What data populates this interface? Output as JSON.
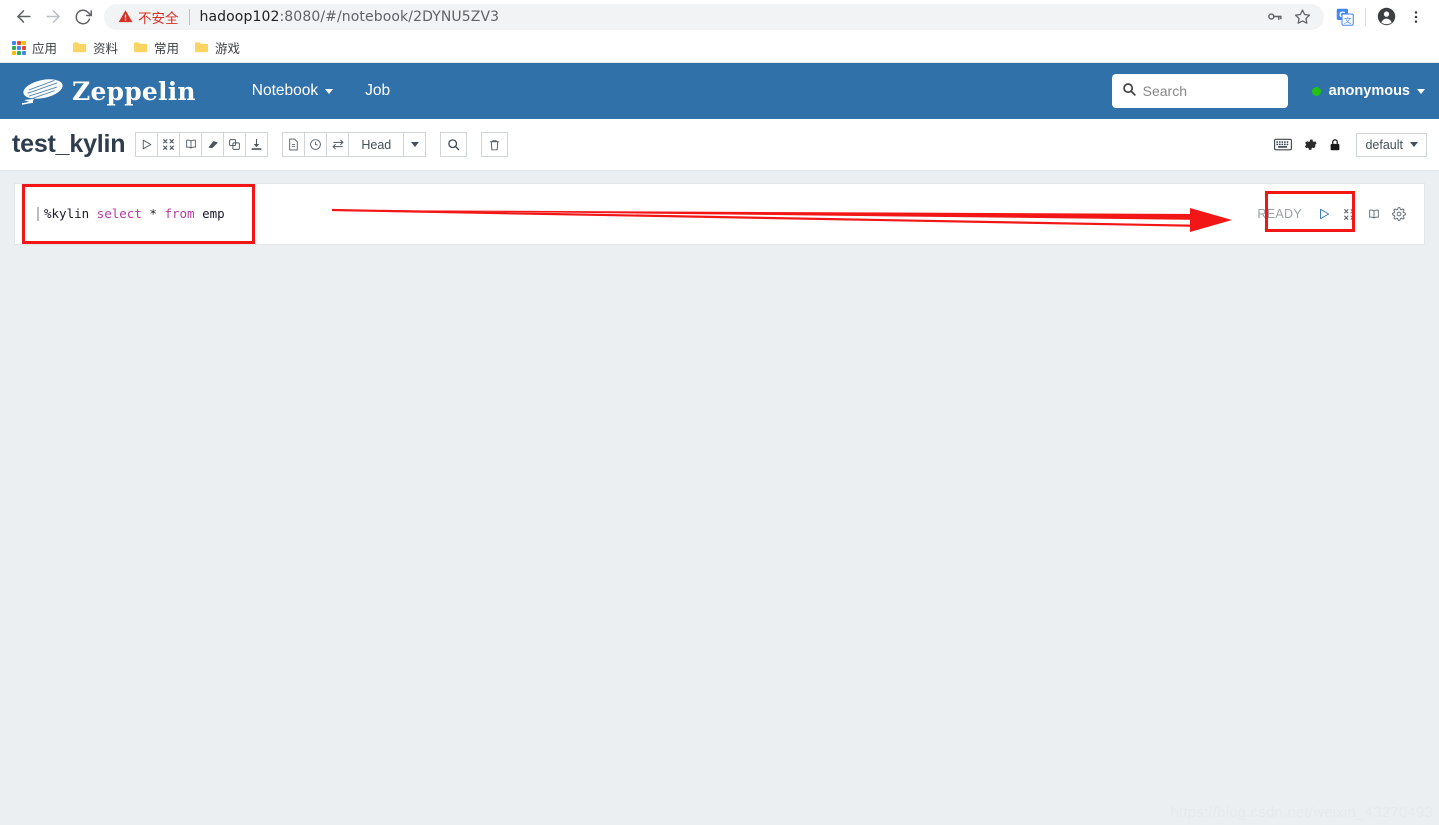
{
  "browser": {
    "back_icon": "arrow-left-icon",
    "forward_icon": "arrow-right-icon",
    "reload_icon": "reload-icon",
    "security_label": "不安全",
    "url_host": "hadoop102",
    "url_rest": ":8080/#/notebook/2DYNU5ZV3",
    "url_full": "hadoop102:8080/#/notebook/2DYNU5ZV3",
    "omnibox_icons": [
      "key-icon",
      "star-icon"
    ],
    "extension_icons": [
      "google-translate-icon",
      "profile-avatar-icon",
      "three-dot-menu-icon"
    ],
    "bookmarks": [
      {
        "label": "应用",
        "icon": "apps-grid-icon"
      },
      {
        "label": "资料",
        "icon": "folder-icon"
      },
      {
        "label": "常用",
        "icon": "folder-icon"
      },
      {
        "label": "游戏",
        "icon": "folder-icon"
      }
    ]
  },
  "navbar": {
    "brand": "Zeppelin",
    "brand_icon": "zeppelin-blimp-icon",
    "links": [
      {
        "label": "Notebook",
        "has_caret": true
      },
      {
        "label": "Job",
        "has_caret": false
      }
    ],
    "search": {
      "placeholder": "Search",
      "value": "",
      "icon": "search-icon"
    },
    "user": {
      "name": "anonymous",
      "status_color": "#24c312",
      "has_caret": true
    },
    "background_color": "#3071a9"
  },
  "toolbar": {
    "notebook_title": "test_kylin",
    "action_buttons": [
      {
        "name": "run-all-paragraphs-button",
        "icon": "play-icon"
      },
      {
        "name": "hide-output-button",
        "icon": "compress-icon"
      },
      {
        "name": "toggle-code-button",
        "icon": "book-icon"
      },
      {
        "name": "clear-output-button",
        "icon": "eraser-icon"
      },
      {
        "name": "clone-notebook-button",
        "icon": "copy-icon"
      },
      {
        "name": "export-notebook-button",
        "icon": "download-icon"
      }
    ],
    "version_buttons": [
      {
        "name": "commit-button",
        "icon": "commit-icon"
      },
      {
        "name": "revision-history-button",
        "icon": "clock-icon"
      },
      {
        "name": "compare-revisions-button",
        "icon": "exchange-icon"
      }
    ],
    "revision_label": "Head",
    "search_code_button": {
      "name": "search-code-button",
      "icon": "search-icon"
    },
    "delete_button": {
      "name": "delete-notebook-button",
      "icon": "trash-icon"
    },
    "right_icons": [
      {
        "name": "keyboard-shortcuts-icon",
        "icon": "keyboard-icon"
      },
      {
        "name": "notebook-settings-icon",
        "icon": "gear-icon"
      },
      {
        "name": "notebook-permissions-icon",
        "icon": "lock-icon"
      }
    ],
    "interpreter_binding": "default"
  },
  "paragraph": {
    "code": {
      "magic": "%kylin",
      "tokens": [
        {
          "text": "%kylin",
          "type": "magic"
        },
        {
          "text": " ",
          "type": "space"
        },
        {
          "text": "select",
          "type": "keyword"
        },
        {
          "text": " ",
          "type": "space"
        },
        {
          "text": "*",
          "type": "operator"
        },
        {
          "text": " ",
          "type": "space"
        },
        {
          "text": "from",
          "type": "keyword"
        },
        {
          "text": " ",
          "type": "space"
        },
        {
          "text": "emp",
          "type": "identifier"
        }
      ],
      "full_text": "%kylin select * from emp"
    },
    "status": "READY",
    "controls": [
      {
        "name": "run-paragraph-button",
        "icon": "play-icon"
      },
      {
        "name": "hide-editor-button",
        "icon": "compress-icon"
      },
      {
        "name": "toggle-output-button",
        "icon": "book-icon"
      },
      {
        "name": "paragraph-settings-button",
        "icon": "gear-icon"
      }
    ]
  },
  "annotations": {
    "highlight_color": "#f31616",
    "editor_box": true,
    "status_box": true,
    "arrow": true
  },
  "watermark": "https://blog.csdn.net/weixin_43270493"
}
